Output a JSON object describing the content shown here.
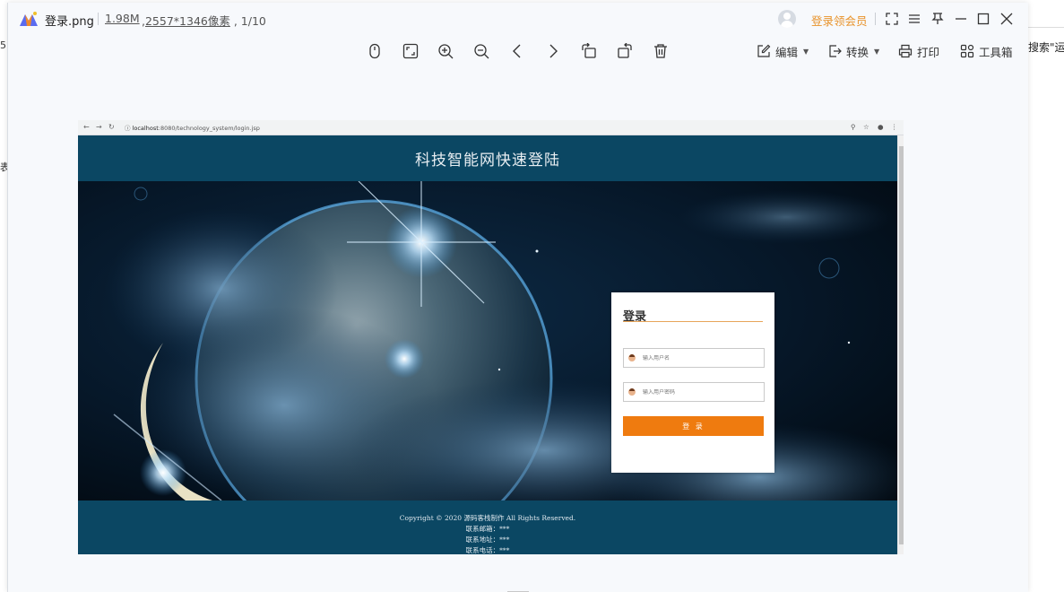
{
  "background_app": {
    "right_peek_text": "搜索\"运行",
    "left_glyph_1": "5",
    "left_glyph_2": "表"
  },
  "viewer": {
    "file_name": "登录.png",
    "file_size": "1.98M",
    "dimensions": "2557*1346像素",
    "page_counter": "1/10",
    "vip_label": "登录领会员",
    "toolbar": {
      "edit_label": "编辑",
      "convert_label": "转换",
      "print_label": "打印",
      "toolbox_label": "工具箱"
    },
    "accent_color": "#e8932b"
  },
  "screenshot": {
    "browser": {
      "url_host": "localhost",
      "url_rest": ":8080/technology_system/login.jsp"
    },
    "page": {
      "header_title": "科技智能网快速登陆",
      "header_color": "#0b4763",
      "login": {
        "title": "登录",
        "username_placeholder": "输入用户名",
        "password_placeholder": "输入用户密码",
        "submit_label": "登 录",
        "button_color": "#ef7b0f"
      },
      "footer": {
        "copyright": "Copyright © 2020 源码客栈制作 All Rights Reserved.",
        "email": "联系邮箱：***",
        "address": "联系地址：***",
        "phone": "联系电话：***"
      }
    }
  }
}
